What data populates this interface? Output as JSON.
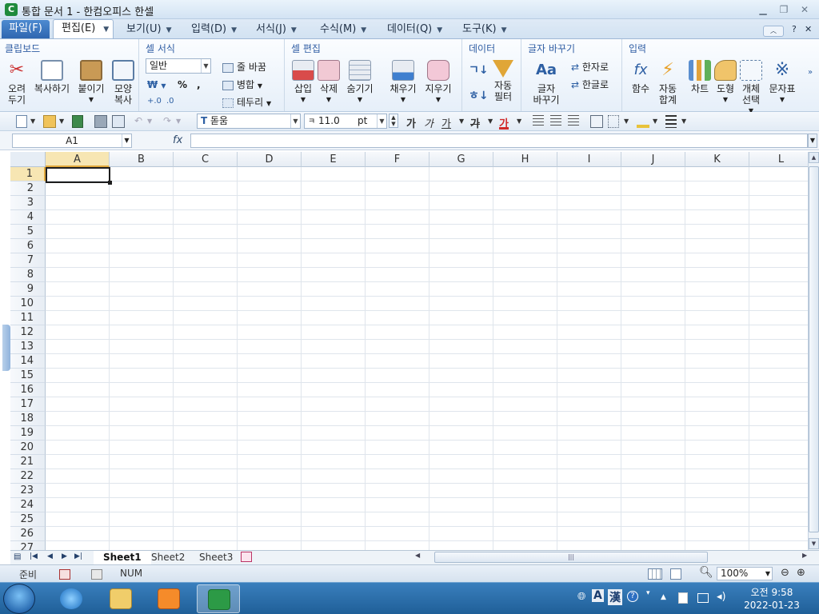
{
  "window": {
    "app_icon": "C",
    "title": "통합 문서 1 - 한컴오피스 한셀"
  },
  "menus": {
    "file": "파일(F)",
    "edit": "편집(E)",
    "view": "보기(U)",
    "input": "입력(D)",
    "format": "서식(J)",
    "formula": "수식(M)",
    "data": "데이터(Q)",
    "tools": "도구(K)",
    "help": "?"
  },
  "ribbon": {
    "clipboard": {
      "title": "클립보드",
      "cut": "오려\n두기",
      "copy": "복사하기",
      "paste": "붙이기",
      "format_copy": "모양\n복사"
    },
    "cell_format": {
      "title": "셀 서식",
      "number_format": "일반",
      "wrap": "줄 바꿈",
      "merge": "병합",
      "border": "테두리"
    },
    "cell_edit": {
      "title": "셀 편집",
      "insert": "삽입",
      "delete": "삭제",
      "hide": "숨기기",
      "fill": "채우기",
      "clear": "지우기"
    },
    "data": {
      "title": "데이터",
      "sort_asc": "ㄱ",
      "sort_desc": "ㅎ",
      "auto_filter": "자동\n필터"
    },
    "char_change": {
      "title": "글자 바꾸기",
      "change": "글자\n바꾸기",
      "to_hanja": "한자로",
      "to_hangul": "한글로"
    },
    "input": {
      "title": "입력",
      "function": "함수",
      "autosum": "자동\n합계",
      "chart": "차트",
      "shape": "도형",
      "select_obj": "개체\n선택",
      "symbol": "문자표"
    }
  },
  "toolbar": {
    "font": "돋움",
    "font_size": "11.0",
    "size_unit": "pt",
    "bold": "가",
    "italic": "가",
    "underline": "가",
    "strike": "가",
    "font_color": "가"
  },
  "formula_bar": {
    "name_box": "A1",
    "fx": "fx",
    "formula": ""
  },
  "grid": {
    "columns": [
      "A",
      "B",
      "C",
      "D",
      "E",
      "F",
      "G",
      "H",
      "I",
      "J",
      "K",
      "L"
    ],
    "rows": [
      "1",
      "2",
      "3",
      "4",
      "5",
      "6",
      "7",
      "8",
      "9",
      "10",
      "11",
      "12",
      "13",
      "14",
      "15",
      "16",
      "17",
      "18",
      "19",
      "20",
      "21",
      "22",
      "23",
      "24",
      "25",
      "26",
      "27"
    ],
    "active_column": "A",
    "active_row": "1"
  },
  "sheets": {
    "tabs": [
      "Sheet1",
      "Sheet2",
      "Sheet3"
    ],
    "active": "Sheet1"
  },
  "status": {
    "mode": "준비",
    "num": "NUM",
    "zoom": "100%"
  },
  "taskbar": {
    "time": "오전 9:58",
    "date": "2022-01-23",
    "ime_a": "A",
    "ime_han": "漢"
  }
}
